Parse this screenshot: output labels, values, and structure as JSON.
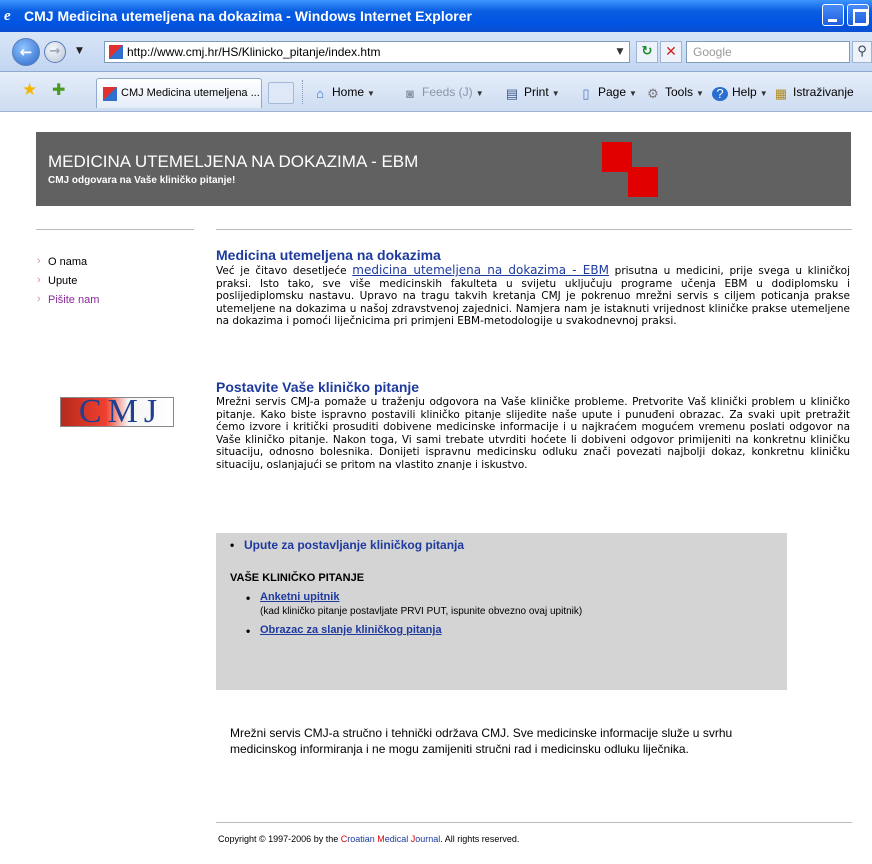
{
  "window": {
    "title": "CMJ Medicina utemeljena na dokazima - Windows Internet Explorer"
  },
  "address_bar": {
    "url": "http://www.cmj.hr/HS/Klinicko_pitanje/index.htm",
    "search_placeholder": "Google"
  },
  "command_bar": {
    "tab_label": "CMJ Medicina utemeljena ...",
    "home": "Home",
    "feeds": "Feeds (J)",
    "print": "Print",
    "page": "Page",
    "tools": "Tools",
    "help": "Help",
    "research": "Istraživanje"
  },
  "header": {
    "title": "MEDICINA UTEMELJENA NA DOKAZIMA - EBM",
    "subtitle": "CMJ odgovara na Vaše kliničko pitanje!"
  },
  "sidebar": {
    "items": [
      {
        "label": "O nama"
      },
      {
        "label": "Upute"
      },
      {
        "label": "Pišite nam"
      }
    ],
    "logo_text": "CMJ"
  },
  "section1": {
    "heading": "Medicina utemeljena na dokazima",
    "text_before": "Već je čitavo desetljeće ",
    "link": "medicina utemeljena na dokazima - EBM",
    "text_after": " prisutna u medicini, prije svega u kliničkoj praksi. Isto tako, sve više medicinskih fakulteta u svijetu uključuju programe učenja EBM u dodiplomsku i poslijediplomsku nastavu. Upravo na tragu takvih kretanja CMJ je pokrenuo mrežni servis s ciljem poticanja prakse utemeljene na dokazima u našoj zdravstvenoj zajednici. Namjera nam je istaknuti vrijednost kliničke prakse utemeljene na dokazima i pomoći liječnicima pri primjeni EBM-metodologije u svakodnevnoj praksi."
  },
  "section2": {
    "heading": "Postavite Vaše kliničko pitanje",
    "text": "Mrežni servis CMJ-a pomaže u traženju odgovora na Vaše kliničke probleme. Pretvorite Vaš klinički problem u kliničko pitanje. Kako biste ispravno postavili kliničko pitanje slijedite naše upute i punuđeni obrazac. Za svaki upit pretražit ćemo izvore i kritički prosuditi dobivene medicinske informacije i u najkraćem mogućem vremenu poslati odgovor na Vaše kliničko pitanje. Nakon toga, Vi sami trebate utvrditi hoćete li dobiveni odgovor primijeniti na konkretnu kliničku situaciju, odnosno bolesnika. Donijeti ispravnu medicinsku odluku znači povezati najbolji dokaz, konkretnu kliničku situaciju, oslanjajući se pritom na vlastito znanje i iskustvo."
  },
  "graybox": {
    "link_instructions": "Upute za postavljanje kliničkog pitanja",
    "heading": "VAŠE KLINIČKO PITANJE",
    "link_survey": "Anketni upitnik",
    "survey_note": "(kad kliničko pitanje postavljate PRVI PUT, ispunite obvezno ovaj upitnik)",
    "link_form": "Obrazac za slanje kliničkog pitanja"
  },
  "disclaimer": "Mrežni servis CMJ-a stručno i tehnički održava CMJ. Sve medicinske informacije služe u svrhu medicinskog informiranja i ne mogu zamijeniti stručni rad i medicinsku odluku liječnika.",
  "footer": {
    "copyright_pre": "Copyright © 1997-2006 by the ",
    "w1_initial": "C",
    "w1_rest": "roatian ",
    "w2_initial": "M",
    "w2_rest": "edical ",
    "w3_initial": "J",
    "w3_rest": "ournal",
    "copyright_post": ". All rights reserved."
  }
}
